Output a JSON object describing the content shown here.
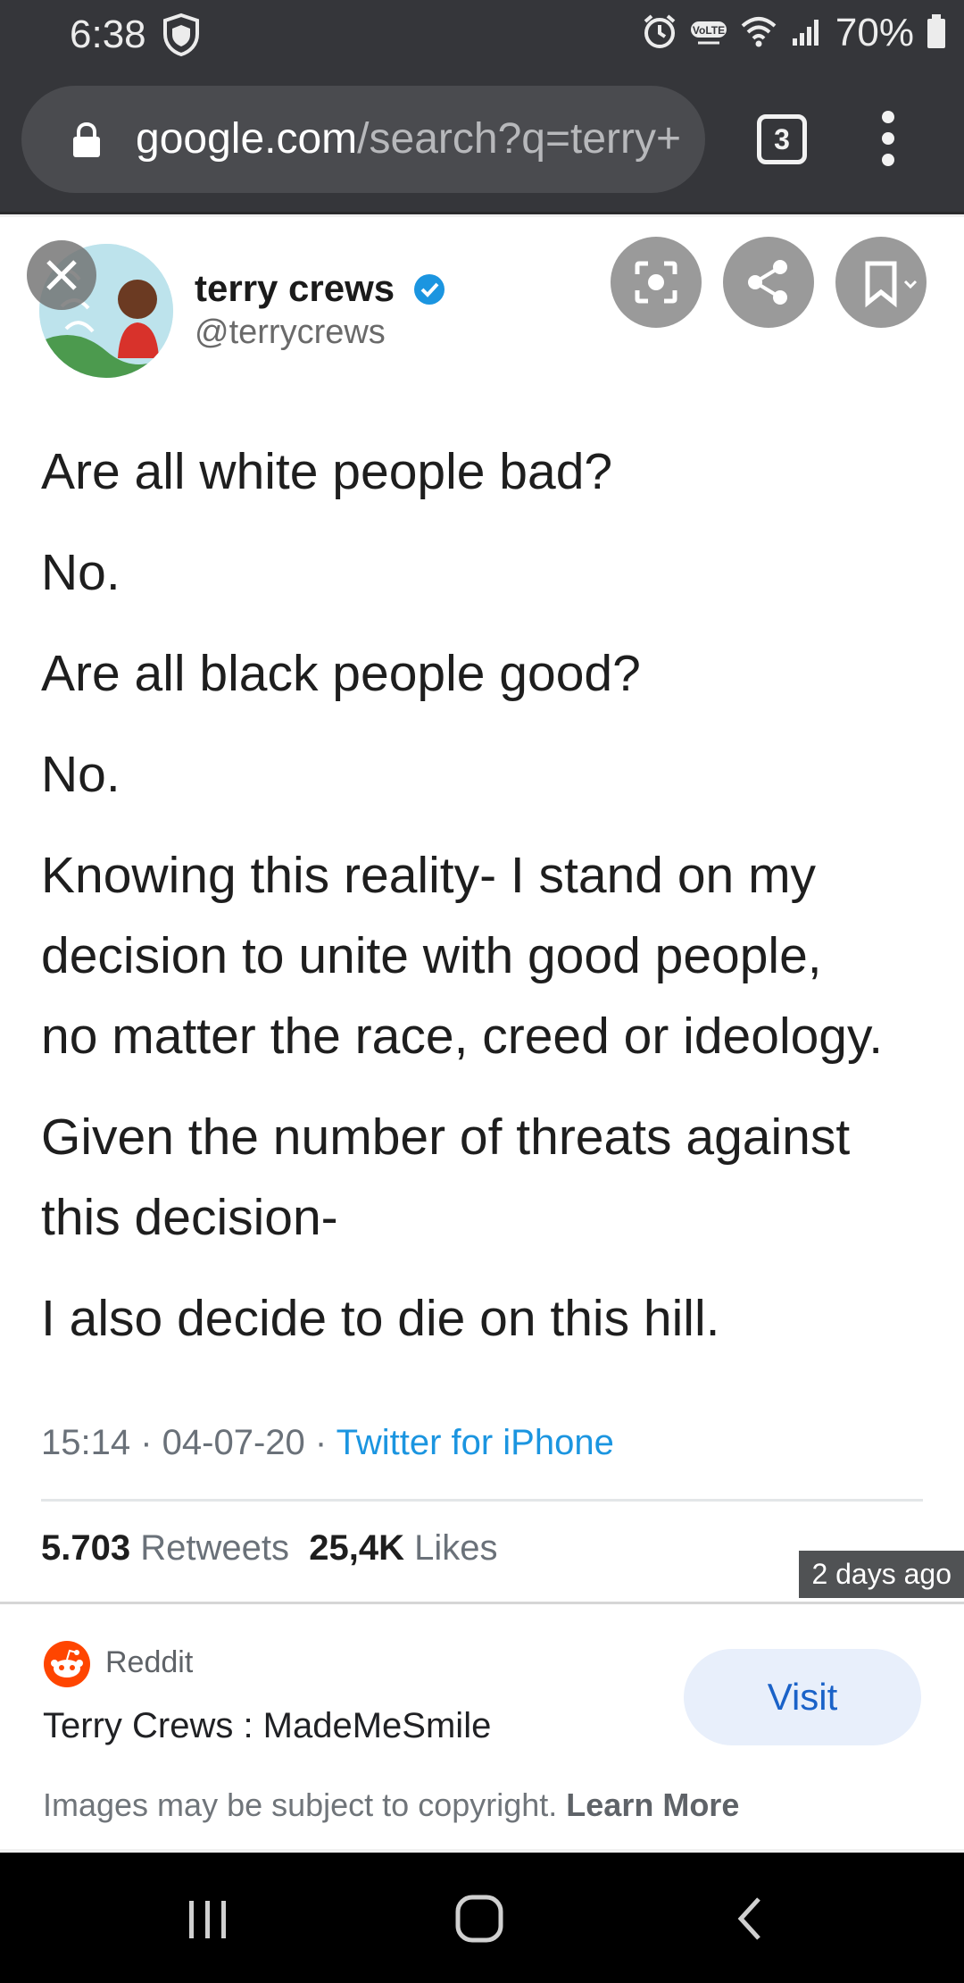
{
  "status_bar": {
    "time": "6:38",
    "battery": "70%",
    "icons": [
      "shield-icon",
      "alarm-icon",
      "volte-icon",
      "wifi-icon",
      "signal-icon",
      "battery-icon"
    ]
  },
  "browser": {
    "url_domain": "google.com",
    "url_path": "/search?q=terry+",
    "tab_count": "3"
  },
  "tweet": {
    "name": "terry crews",
    "handle": "@terrycrews",
    "lines": [
      "Are all white people bad?",
      "No.",
      "Are all black people good?",
      "No.",
      "Knowing this reality- I stand on my",
      "decision to unite with good people,",
      "no matter the race, creed or ideology.",
      "Given the number of threats against",
      "this decision-",
      "I also decide to die on this hill."
    ],
    "time": "15:14 · 04-07-20 · ",
    "source": "Twitter for iPhone",
    "retweets_count": "5.703",
    "retweets_label": "Retweets",
    "likes_count": "25,4K",
    "likes_label": "Likes"
  },
  "image_badge": "2 days ago",
  "result": {
    "source": "Reddit",
    "title": "Terry Crews : MadeMeSmile",
    "visit_label": "Visit",
    "copyright_text": "Images may be subject to copyright. ",
    "learn_more": "Learn More"
  },
  "colors": {
    "chrome_bg": "#35363a",
    "twitter_blue": "#1b95e0",
    "reddit_orange": "#ff4500",
    "visit_bg": "#e8effb",
    "visit_text": "#1a62c8"
  }
}
